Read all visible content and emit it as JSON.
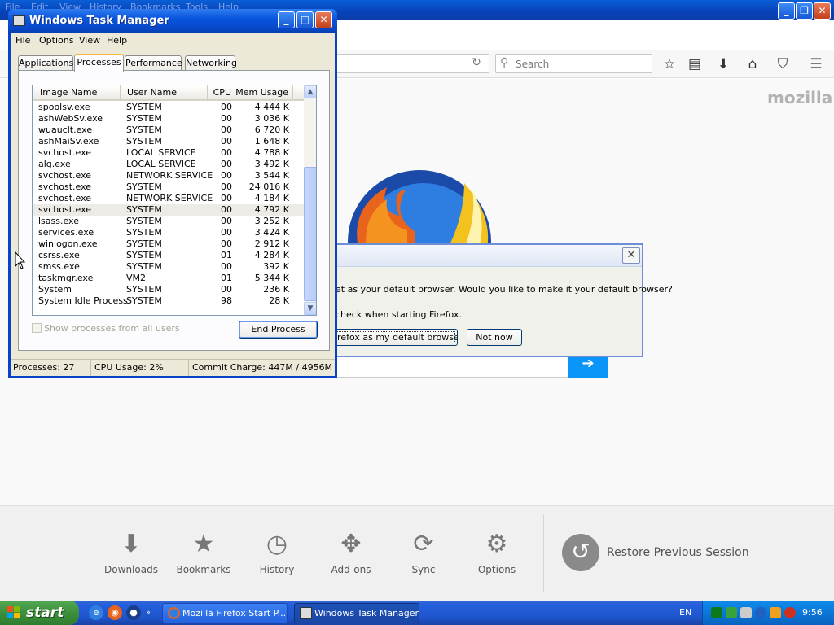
{
  "firefox": {
    "menu_ghost": [
      "File",
      "Edit",
      "View",
      "History",
      "Bookmarks",
      "Tools",
      "Help"
    ],
    "search_placeholder": "Search",
    "brand": "mozilla",
    "launchers": [
      "Downloads",
      "Bookmarks",
      "History",
      "Add-ons",
      "Sync",
      "Options"
    ],
    "restore_label": "Restore Previous Session",
    "search_go_glyph": "➔"
  },
  "dialog": {
    "message": "et as your default browser. Would you like to make it your default browser?",
    "check_label": "check when starting Firefox.",
    "btn_default": "irefox as my default browser",
    "btn_notnow": "Not now",
    "close_glyph": "✕"
  },
  "taskmanager": {
    "title": "Windows Task Manager",
    "menus": [
      "File",
      "Options",
      "View",
      "Help"
    ],
    "tabs": [
      "Applications",
      "Processes",
      "Performance",
      "Networking"
    ],
    "active_tab": "Processes",
    "columns": [
      "Image Name",
      "User Name",
      "CPU",
      "Mem Usage"
    ],
    "processes": [
      {
        "name": "spoolsv.exe",
        "user": "SYSTEM",
        "cpu": "00",
        "mem": "4 444 K"
      },
      {
        "name": "ashWebSv.exe",
        "user": "SYSTEM",
        "cpu": "00",
        "mem": "3 036 K"
      },
      {
        "name": "wuauclt.exe",
        "user": "SYSTEM",
        "cpu": "00",
        "mem": "6 720 K"
      },
      {
        "name": "ashMaiSv.exe",
        "user": "SYSTEM",
        "cpu": "00",
        "mem": "1 648 K"
      },
      {
        "name": "svchost.exe",
        "user": "LOCAL SERVICE",
        "cpu": "00",
        "mem": "4 788 K"
      },
      {
        "name": "alg.exe",
        "user": "LOCAL SERVICE",
        "cpu": "00",
        "mem": "3 492 K"
      },
      {
        "name": "svchost.exe",
        "user": "NETWORK SERVICE",
        "cpu": "00",
        "mem": "3 544 K"
      },
      {
        "name": "svchost.exe",
        "user": "SYSTEM",
        "cpu": "00",
        "mem": "24 016 K"
      },
      {
        "name": "svchost.exe",
        "user": "NETWORK SERVICE",
        "cpu": "00",
        "mem": "4 184 K"
      },
      {
        "name": "svchost.exe",
        "user": "SYSTEM",
        "cpu": "00",
        "mem": "4 792 K"
      },
      {
        "name": "lsass.exe",
        "user": "SYSTEM",
        "cpu": "00",
        "mem": "3 252 K"
      },
      {
        "name": "services.exe",
        "user": "SYSTEM",
        "cpu": "00",
        "mem": "3 424 K"
      },
      {
        "name": "winlogon.exe",
        "user": "SYSTEM",
        "cpu": "00",
        "mem": "2 912 K"
      },
      {
        "name": "csrss.exe",
        "user": "SYSTEM",
        "cpu": "01",
        "mem": "4 284 K"
      },
      {
        "name": "smss.exe",
        "user": "SYSTEM",
        "cpu": "00",
        "mem": "392 K"
      },
      {
        "name": "taskmgr.exe",
        "user": "VM2",
        "cpu": "01",
        "mem": "5 344 K"
      },
      {
        "name": "System",
        "user": "SYSTEM",
        "cpu": "00",
        "mem": "236 K"
      },
      {
        "name": "System Idle Process",
        "user": "SYSTEM",
        "cpu": "98",
        "mem": "28 K"
      }
    ],
    "selected_row": 9,
    "show_all_label": "Show processes from all users",
    "end_process_label": "End Process",
    "status": {
      "processes": "Processes: 27",
      "cpu": "CPU Usage: 2%",
      "commit": "Commit Charge: 447M / 4956M"
    }
  },
  "taskbar": {
    "start_label": "start",
    "tasks": [
      "Mozilla Firefox Start P...",
      "Windows Task Manager"
    ],
    "language": "EN",
    "clock": "9:56"
  }
}
